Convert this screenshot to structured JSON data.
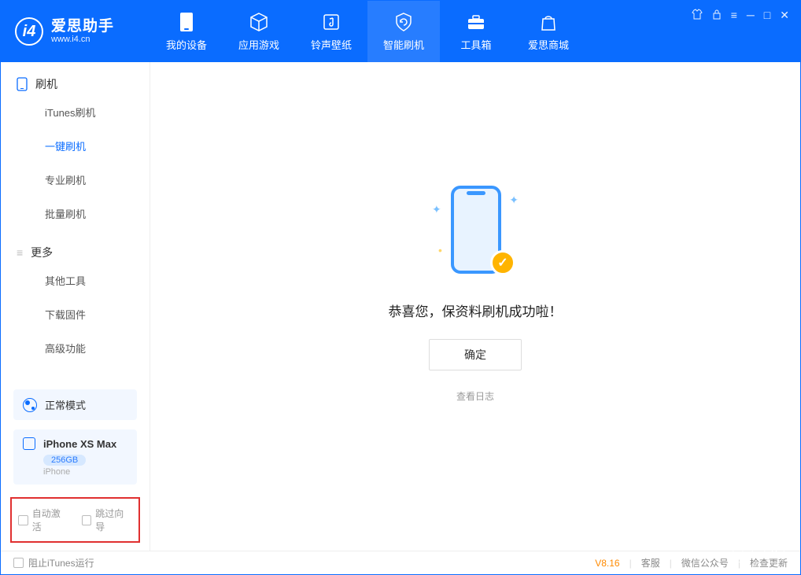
{
  "app": {
    "title": "爱思助手",
    "subtitle": "www.i4.cn"
  },
  "nav": {
    "items": [
      {
        "label": "我的设备"
      },
      {
        "label": "应用游戏"
      },
      {
        "label": "铃声壁纸"
      },
      {
        "label": "智能刷机"
      },
      {
        "label": "工具箱"
      },
      {
        "label": "爱思商城"
      }
    ]
  },
  "sidebar": {
    "group1": {
      "title": "刷机"
    },
    "items1": [
      {
        "label": "iTunes刷机"
      },
      {
        "label": "一键刷机"
      },
      {
        "label": "专业刷机"
      },
      {
        "label": "批量刷机"
      }
    ],
    "group2": {
      "title": "更多"
    },
    "items2": [
      {
        "label": "其他工具"
      },
      {
        "label": "下载固件"
      },
      {
        "label": "高级功能"
      }
    ],
    "mode": "正常模式",
    "device": {
      "name": "iPhone XS Max",
      "storage": "256GB",
      "type": "iPhone"
    },
    "chk_auto": "自动激活",
    "chk_skip": "跳过向导"
  },
  "main": {
    "success": "恭喜您，保资料刷机成功啦！",
    "confirm": "确定",
    "view_log": "查看日志"
  },
  "footer": {
    "block_itunes": "阻止iTunes运行",
    "version": "V8.16",
    "links": [
      "客服",
      "微信公众号",
      "检查更新"
    ]
  }
}
